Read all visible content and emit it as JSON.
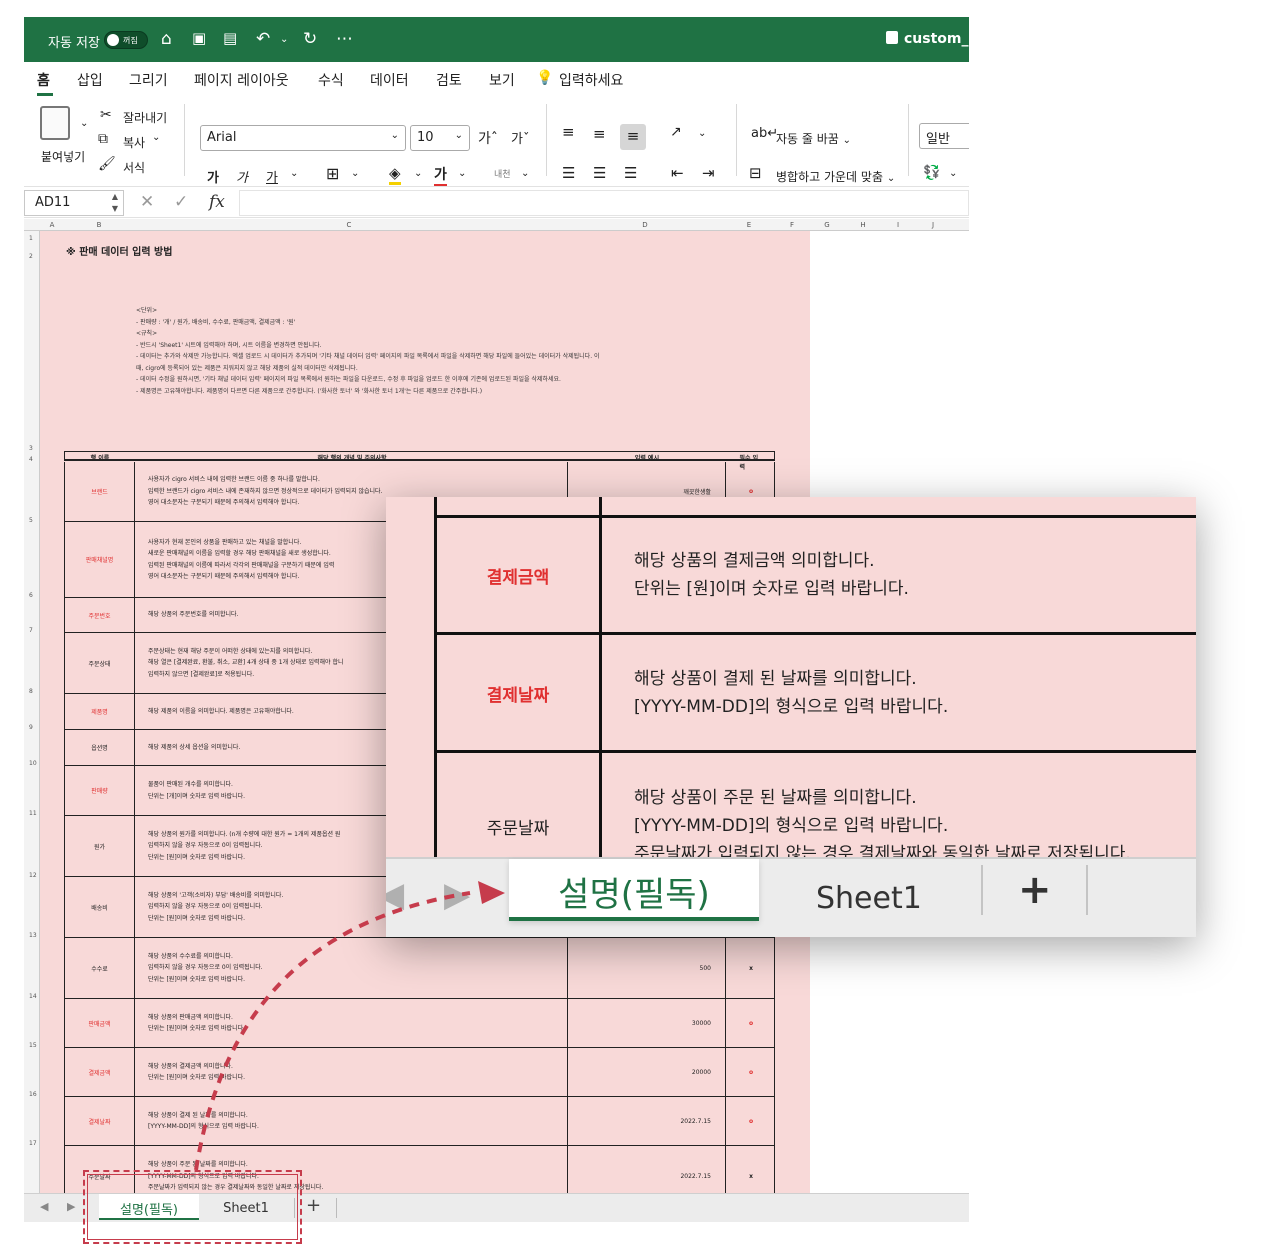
{
  "titlebar": {
    "autosave_label": "자동 저장",
    "autosave_state": "꺼짐",
    "filename": "custom_"
  },
  "ribbon_tabs": [
    "홈",
    "삽입",
    "그리기",
    "페이지 레이아웃",
    "수식",
    "데이터",
    "검토",
    "보기",
    "입력하세요"
  ],
  "ribbon": {
    "paste": "붙여넣기",
    "cut": "잘라내기",
    "copy": "복사",
    "format": "서식",
    "font": "Arial",
    "size": "10",
    "grow": "가ˆ",
    "shrink": "가ˇ",
    "bold": "가",
    "italic": "가",
    "underline": "가",
    "font_color": "가",
    "phonetic": "내천",
    "wrap": "자동 줄 바꿈",
    "merge": "병합하고 가운데 맞춤",
    "number_format": "일반"
  },
  "formula_bar": {
    "cell": "AD11",
    "fx": "fx"
  },
  "columns": [
    "A",
    "B",
    "C",
    "D",
    "E",
    "F",
    "G",
    "H",
    "I",
    "J"
  ],
  "rows": [
    "1",
    "2",
    "3",
    "4",
    "5",
    "6",
    "7",
    "8",
    "9",
    "10",
    "11",
    "12",
    "13",
    "14",
    "15",
    "16",
    "17"
  ],
  "sheet": {
    "title": "※ 판매 데이터 입력 방법",
    "notes": [
      "<단위>",
      "- 판매량 : '개' / 원가, 배송비, 수수료, 판매금액, 결제금액 : '원'",
      "",
      "<규칙>",
      "- 반드시 'Sheet1' 시트에 입력해야 하며, 시트 이름을 변경하면 안됩니다.",
      "- 데이터는 추가와 삭제만 가능합니다. 엑셀 업로드 시 데이터가 추가되며 '기타 채널 데이터 입력' 페이지의 파일 목록에서 파일을 삭제하면 해당 파일에 들어있는 데이터가 삭제됩니다. 이",
      "때, cigro에 등록되어 있는 제품은 지워지지 않고 해당 제품의 실적 데이터만 삭제됩니다.",
      "- 데이터 수정을 원하시면, '기타 채널 데이터 입력' 페이지의 파일 목록에서 원하는 파일을 다운로드, 수정 후 파일을 업로드 한 이후에 기존에 업로드된 파일을 삭제하세요.",
      "- 제품명은 고유해야합니다. 제품명이 다르면 다른 제품으로 간주합니다. ('화사한 토너' 와 '화사한 토너 1개'는 다른 제품으로 간주합니다.)"
    ],
    "table_headers": [
      "행 이름",
      "해당 행의 개념 및 주의사항",
      "입력 예시",
      "필수 입력"
    ],
    "table_rows": [
      {
        "name": "브랜드",
        "req": true,
        "desc": [
          "사용자가 cigro 서비스 내에 입력한 브랜드 이름 중 하나를 말합니다.",
          "입력한 브랜드가 cigro 서비스 내에 존재하지 않으면 정상적으로 데이터가 입력되지 않습니다.",
          "영어 대소문자는 구분되기 때문에 주의해서 입력해야 합니다."
        ],
        "example": "깨끗한생활",
        "mark": "o"
      },
      {
        "name": "판매채널명",
        "req": true,
        "desc": [
          "사용자가 현재 본인의 상품을 판매하고 있는 채널을 말합니다.",
          "새로운 판매채널의 이름을 입력할 경우 해당 판매채널을 새로 생성합니다.",
          "입력된 판매채널의 이름에 따라서 각각의 판매채널을 구분하기 때문에 입력",
          "영어 대소문자는 구분되기 때문에 주의해서 입력해야 합니다."
        ],
        "example": "",
        "mark": ""
      },
      {
        "name": "주문번호",
        "req": true,
        "desc": [
          "해당 상품의 주문번호를 의미합니다."
        ],
        "example": "",
        "mark": ""
      },
      {
        "name": "주문상태",
        "req": false,
        "desc": [
          "주문상태는 현재 해당 주문이 어떠한 상태에 있는지를 의미합니다.",
          "해당 열은 [결제완료, 환불, 취소, 교환] 4개 상태 중 1개 상태로 입력해야 합니",
          "입력하지 않으면 [결제완료]로 적용됩니다."
        ],
        "example": "",
        "mark": ""
      },
      {
        "name": "제품명",
        "req": true,
        "desc": [
          "해당 제품의 이름을 의미합니다. 제품명은 고유해야합니다."
        ],
        "example": "",
        "mark": ""
      },
      {
        "name": "옵션명",
        "req": false,
        "desc": [
          "해당 제품의 상세 옵션을 의미합니다."
        ],
        "example": "",
        "mark": ""
      },
      {
        "name": "판매량",
        "req": true,
        "desc": [
          "물품이 판매된 개수를 의미합니다.",
          "단위는 [개]이며 숫자로 입력 바랍니다."
        ],
        "example": "",
        "mark": ""
      },
      {
        "name": "원가",
        "req": false,
        "desc": [
          "해당 상품의 원가를 의미합니다. (n개 수량에 대한 원가 = 1개의 제품옵션 원",
          "입력하지 않을 경우 자동으로 0이 입력됩니다.",
          "단위는 [원]이며 숫자로 입력 바랍니다."
        ],
        "example": "",
        "mark": ""
      },
      {
        "name": "배송비",
        "req": false,
        "desc": [
          "해당 상품의 '고객(소비자) 부담' 배송비를 의미합니다.",
          "입력하지 않을 경우 자동으로 0이 입력됩니다.",
          "단위는 [원]이며 숫자로 입력 바랍니다."
        ],
        "example": "",
        "mark": ""
      },
      {
        "name": "수수료",
        "req": false,
        "desc": [
          "해당 상품의 수수료를 의미합니다.",
          "입력하지 않을 경우 자동으로 0이 입력됩니다.",
          "단위는 [원]이며 숫자로 입력 바랍니다."
        ],
        "example": "500",
        "mark": "x"
      },
      {
        "name": "판매금액",
        "req": true,
        "desc": [
          "해당 상품의 판매금액 의미합니다.",
          "단위는 [원]이며 숫자로 입력 바랍니다."
        ],
        "example": "30000",
        "mark": "o"
      },
      {
        "name": "결제금액",
        "req": true,
        "desc": [
          "해당 상품의 결제금액 의미합니다.",
          "단위는 [원]이며 숫자로 입력 바랍니다."
        ],
        "example": "20000",
        "mark": "o"
      },
      {
        "name": "결제날짜",
        "req": true,
        "desc": [
          "해당 상품이 결제 된 날짜를 의미합니다.",
          "[YYYY-MM-DD]의 형식으로 입력 바랍니다."
        ],
        "example": "2022.7.15",
        "mark": "o"
      },
      {
        "name": "주문날짜",
        "req": false,
        "desc": [
          "해당 상품이 주문 된 날짜를 의미합니다.",
          "[YYYY-MM-DD]의 형식으로 입력 바랍니다.",
          "주문날짜가 입력되지 않는 경우 결제날짜와 동일한 날짜로 저장됩니다."
        ],
        "example": "2022.7.15",
        "mark": "x"
      }
    ]
  },
  "sheet_tabs": {
    "active": "설명(필독)",
    "other": "Sheet1",
    "add": "+"
  },
  "zoom": {
    "rows": [
      {
        "name": "결제금액",
        "req": true,
        "desc": [
          "해당 상품의 결제금액 의미합니다.",
          "단위는 [원]이며 숫자로 입력 바랍니다."
        ]
      },
      {
        "name": "결제날짜",
        "req": true,
        "desc": [
          "해당 상품이 결제 된 날짜를 의미합니다.",
          "[YYYY-MM-DD]의 형식으로 입력 바랍니다."
        ]
      },
      {
        "name": "주문날짜",
        "req": false,
        "desc": [
          "해당 상품이 주문 된 날짜를 의미합니다.",
          "[YYYY-MM-DD]의 형식으로 입력 바랍니다.",
          "주문날짜가 입력되지 않는 경우 결제날짜와 동일한 날짜로 저장됩니다."
        ]
      }
    ]
  },
  "colors": {
    "excel_green": "#1f7244",
    "sheet_bg": "#f8d9d8",
    "required_red": "#e03030",
    "annotation_red": "#c63c4c"
  }
}
